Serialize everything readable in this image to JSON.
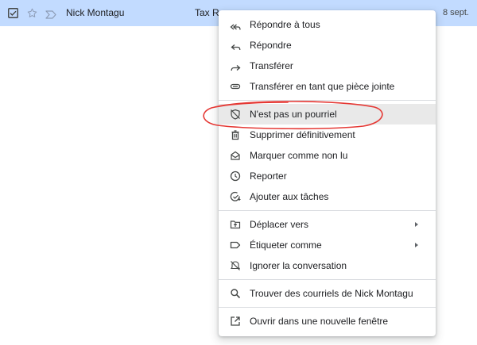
{
  "email_row": {
    "sender": "Nick Montagu",
    "subject_snippet": "Tax Re",
    "date": "8 sept."
  },
  "context_menu": {
    "groups": [
      [
        {
          "label": "Répondre à tous",
          "icon": "reply-all-icon"
        },
        {
          "label": "Répondre",
          "icon": "reply-icon"
        },
        {
          "label": "Transférer",
          "icon": "forward-icon"
        },
        {
          "label": "Transférer en tant que pièce jointe",
          "icon": "attachment-icon"
        }
      ],
      [
        {
          "label": "N'est pas un pourriel",
          "icon": "not-spam-icon",
          "highlighted": true
        },
        {
          "label": "Supprimer définitivement",
          "icon": "trash-icon"
        },
        {
          "label": "Marquer comme non lu",
          "icon": "mark-unread-icon"
        },
        {
          "label": "Reporter",
          "icon": "snooze-clock-icon"
        },
        {
          "label": "Ajouter aux tâches",
          "icon": "add-task-icon"
        }
      ],
      [
        {
          "label": "Déplacer vers",
          "icon": "move-to-folder-icon",
          "submenu": true
        },
        {
          "label": "Étiqueter comme",
          "icon": "label-icon",
          "submenu": true
        },
        {
          "label": "Ignorer la conversation",
          "icon": "mute-icon"
        }
      ],
      [
        {
          "label": "Trouver des courriels de Nick Montagu",
          "icon": "search-icon"
        }
      ],
      [
        {
          "label": "Ouvrir dans une nouvelle fenêtre",
          "icon": "open-new-window-icon"
        }
      ]
    ]
  },
  "colors": {
    "row_selected": "#c2dbff",
    "menu_highlight": "#e9e9e9",
    "annotation_red": "#e53935",
    "icon_gray": "#444746"
  }
}
